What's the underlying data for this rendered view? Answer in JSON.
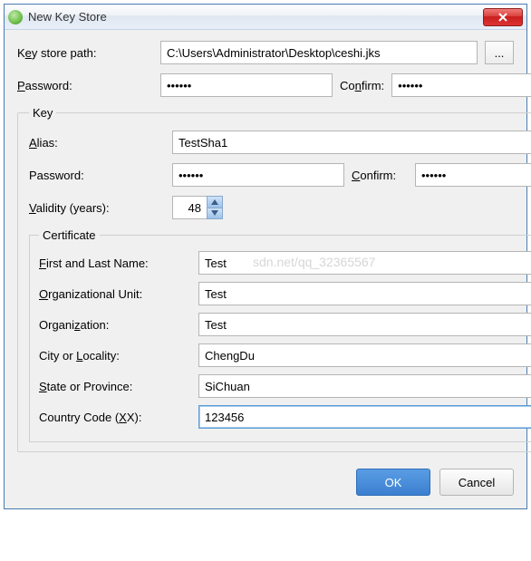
{
  "window": {
    "title": "New Key Store"
  },
  "keystore": {
    "path_label_pre": "K",
    "path_label_u": "e",
    "path_label_post": "y store path:",
    "path_value": "C:\\Users\\Administrator\\Desktop\\ceshi.jks",
    "browse_label": "...",
    "password_label_pre": "",
    "password_label_u": "P",
    "password_label_post": "assword:",
    "password_value": "••••••",
    "confirm_label_pre": "Co",
    "confirm_label_u": "n",
    "confirm_label_post": "firm:",
    "confirm_value": "••••••"
  },
  "key": {
    "legend": "Key",
    "alias_label_pre": "",
    "alias_label_u": "A",
    "alias_label_post": "lias:",
    "alias_value": "TestSha1",
    "password_label": "Password:",
    "password_value": "••••••",
    "confirm_label_pre": "",
    "confirm_label_u": "C",
    "confirm_label_post": "onfirm:",
    "confirm_value": "••••••",
    "validity_label_pre": "",
    "validity_label_u": "V",
    "validity_label_post": "alidity (years):",
    "validity_value": "48"
  },
  "certificate": {
    "legend": "Certificate",
    "first_last_pre": "",
    "first_last_u": "F",
    "first_last_post": "irst and Last Name:",
    "first_last_value": "Test",
    "org_unit_pre": "",
    "org_unit_u": "O",
    "org_unit_post": "rganizational Unit:",
    "org_unit_value": "Test",
    "org_pre": "Organi",
    "org_u": "z",
    "org_post": "ation:",
    "org_value": "Test",
    "city_pre": "City or ",
    "city_u": "L",
    "city_post": "ocality:",
    "city_value": "ChengDu",
    "state_pre": "",
    "state_u": "S",
    "state_post": "tate or Province:",
    "state_value": "SiChuan",
    "country_pre": "Country Code (",
    "country_u": "X",
    "country_post": "X):",
    "country_value": "123456"
  },
  "buttons": {
    "ok": "OK",
    "cancel": "Cancel"
  },
  "watermark": "sdn.net/qq_32365567"
}
